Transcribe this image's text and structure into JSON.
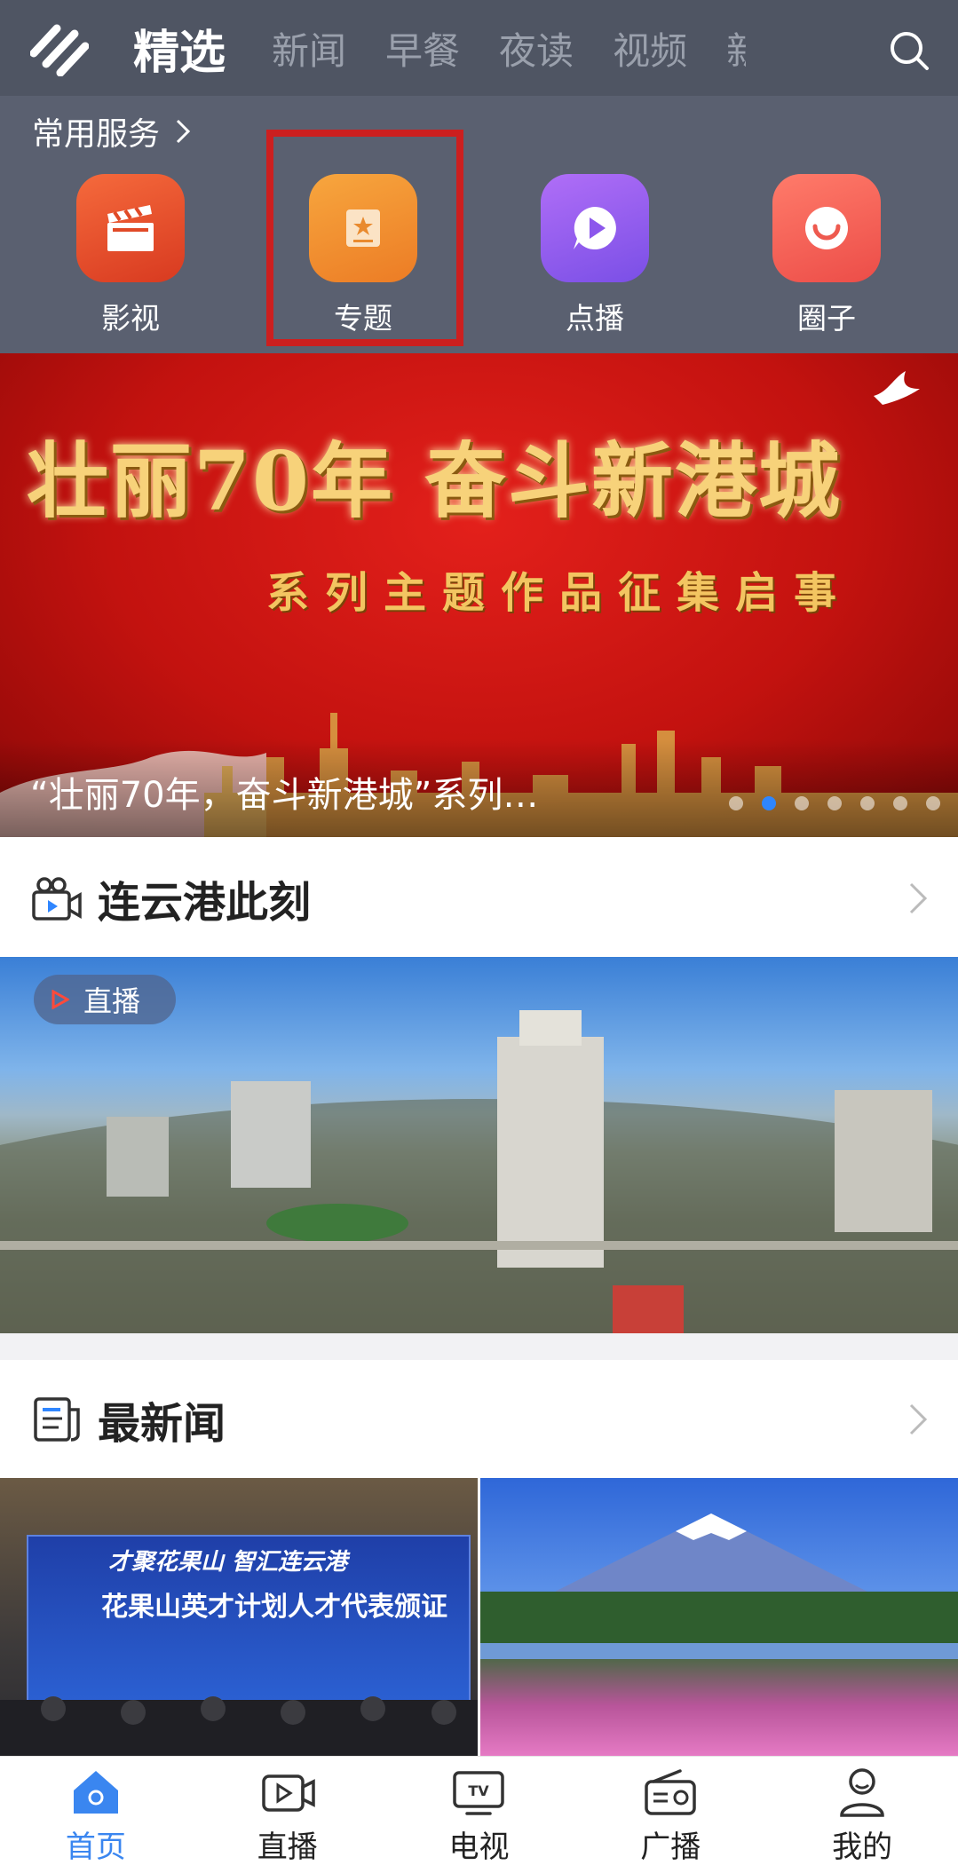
{
  "nav": {
    "tabs": [
      "精选",
      "新闻",
      "早餐",
      "夜读",
      "视频",
      "新"
    ],
    "active_tab": 0
  },
  "services": {
    "title": "常用服务",
    "items": [
      {
        "label": "影视",
        "icon": "clapperboard-icon"
      },
      {
        "label": "专题",
        "icon": "star-card-icon"
      },
      {
        "label": "点播",
        "icon": "play-bubble-icon"
      },
      {
        "label": "圈子",
        "icon": "smile-icon"
      }
    ]
  },
  "banner": {
    "headline": "壮丽70年 奋斗新港城",
    "subheadline": "系列主题作品征集启事",
    "caption": "“壮丽70年，奋斗新港城”系列…",
    "slide_count": 7,
    "active_slide": 1
  },
  "section_live": {
    "title": "连云港此刻",
    "badge": "直播"
  },
  "section_news": {
    "title": "最新闻",
    "thumb1_line1": "才聚花果山  智汇连云港",
    "thumb1_line2": "花果山英才计划人才代表颁证"
  },
  "bottom_nav": {
    "items": [
      {
        "label": "首页",
        "icon": "home-icon"
      },
      {
        "label": "直播",
        "icon": "live-video-icon"
      },
      {
        "label": "电视",
        "icon": "tv-icon"
      },
      {
        "label": "广播",
        "icon": "radio-icon"
      },
      {
        "label": "我的",
        "icon": "user-icon"
      }
    ],
    "active": 0
  },
  "colors": {
    "nav_bg": "#4f5563",
    "services_bg": "#5a6070",
    "accent": "#3a86f0",
    "highlight_box": "#cc1f1f"
  }
}
